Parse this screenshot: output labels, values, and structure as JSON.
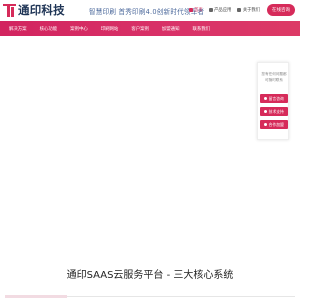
{
  "brand": {
    "name": "通印科技",
    "tagline": "智慧印刷 首秀印刷4.0创新时代领军者",
    "accent_color": "#d62b5a",
    "nav_color": "#d9306a"
  },
  "top_links": [
    {
      "label": "首页",
      "icon": "home-icon"
    },
    {
      "label": "产品应用",
      "icon": "grid-icon"
    },
    {
      "label": "关于我们",
      "icon": "info-icon"
    }
  ],
  "consult_button": "在线咨询",
  "nav": {
    "items": [
      "解决方案",
      "核心功能",
      "案例中心",
      "印刷网站",
      "客户案例",
      "加盟通知",
      "联系我们"
    ]
  },
  "float_panel": {
    "text_line1": "您有任何问题都",
    "text_line2": "可随时联系",
    "buttons": [
      {
        "label": "留言咨询",
        "icon": "chat-icon"
      },
      {
        "label": "技术支持",
        "icon": "tool-icon"
      },
      {
        "label": "合作加盟",
        "icon": "handshake-icon"
      }
    ]
  },
  "section": {
    "title": "通印SAAS云服务平台 - 三大核心系统"
  }
}
